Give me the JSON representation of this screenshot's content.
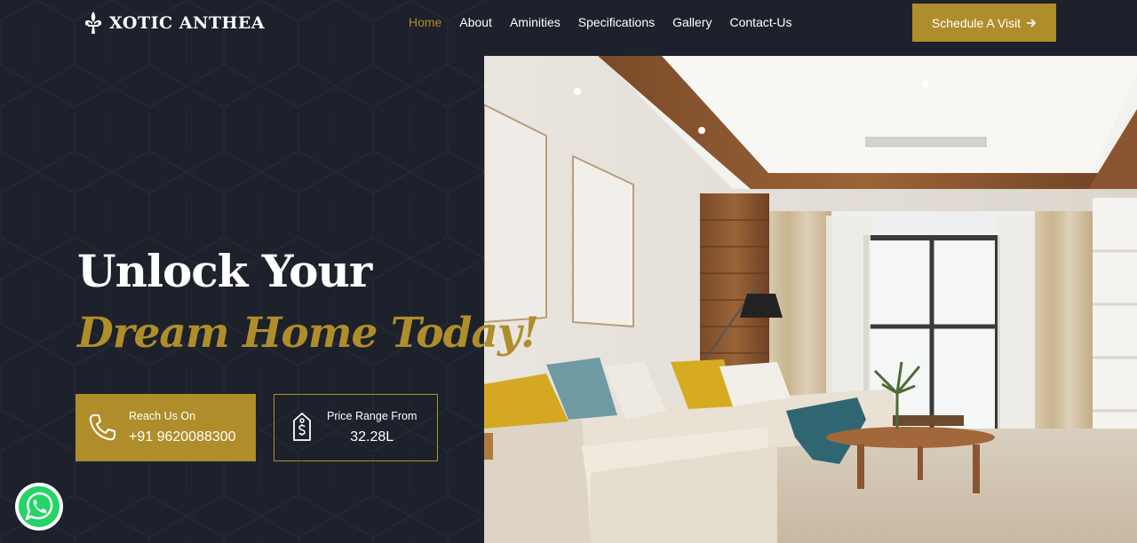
{
  "brand": {
    "name": "XOTIC ANTHEA"
  },
  "nav": {
    "items": [
      {
        "label": "Home",
        "active": true
      },
      {
        "label": "About",
        "active": false
      },
      {
        "label": "Aminities",
        "active": false
      },
      {
        "label": "Specifications",
        "active": false
      },
      {
        "label": "Gallery",
        "active": false
      },
      {
        "label": "Contact-Us",
        "active": false
      }
    ]
  },
  "cta": {
    "label": "Schedule A Visit",
    "icon": "arrow-right-icon"
  },
  "hero": {
    "line1": "Unlock Your",
    "line2": "Dream Home Today!"
  },
  "contact": {
    "label": "Reach Us On",
    "phone": "+91 9620088300",
    "icon": "phone-icon"
  },
  "price": {
    "label": "Price Range From",
    "value": "32.28L",
    "icon": "price-tag-icon"
  },
  "whatsapp": {
    "icon": "whatsapp-icon"
  },
  "colors": {
    "background": "#1c212b",
    "accent": "#b08d2b",
    "text": "#ffffff"
  }
}
